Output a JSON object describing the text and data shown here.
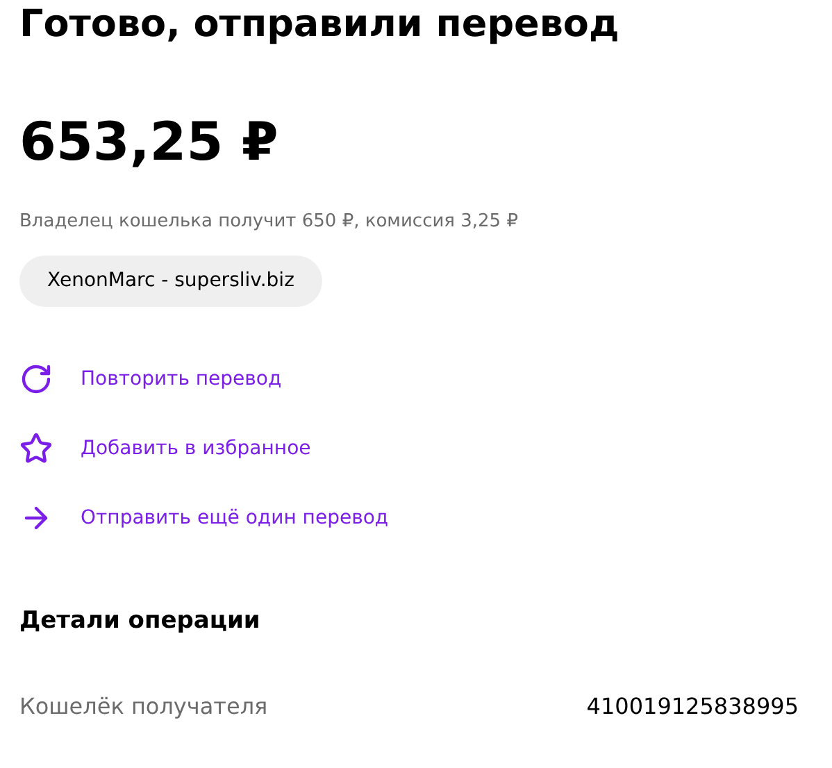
{
  "title": "Готово, отправили перевод",
  "amount": "653,25 ₽",
  "note": "Владелец кошелька получит 650 ₽, комиссия 3,25 ₽",
  "recipient_chip": "XenonMarc - supersliv.biz",
  "actions": [
    {
      "kind": "repeat",
      "label": "Повторить перевод"
    },
    {
      "kind": "favorite",
      "label": "Добавить в избранное"
    },
    {
      "kind": "send",
      "label": "Отправить ещё один перевод"
    }
  ],
  "details": {
    "heading": "Детали операции",
    "rows": [
      {
        "label": "Кошелёк получателя",
        "value": "410019125838995"
      }
    ]
  }
}
